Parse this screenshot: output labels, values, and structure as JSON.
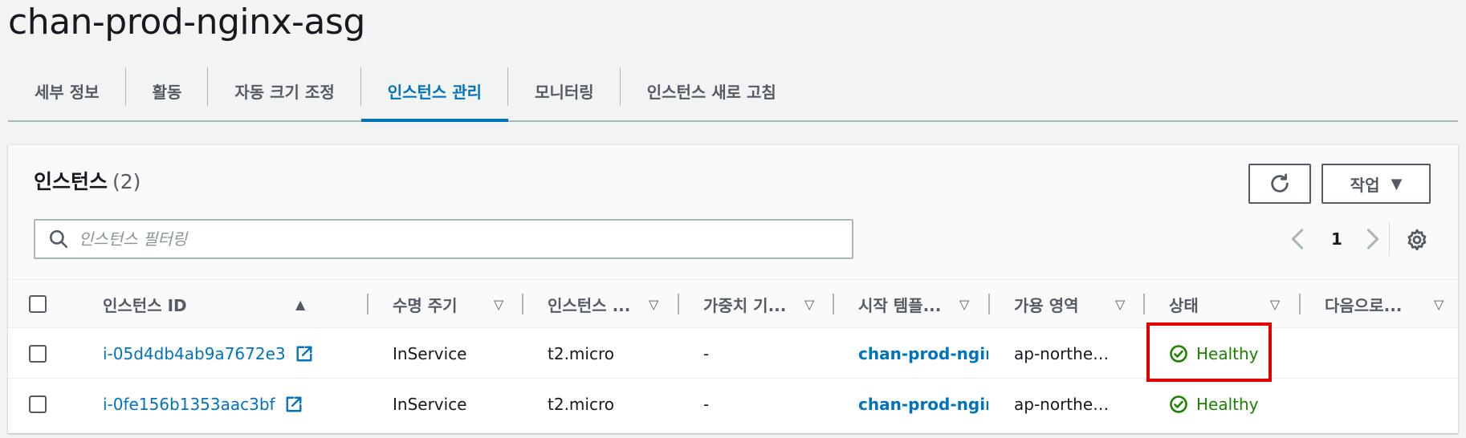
{
  "page": {
    "title": "chan-prod-nginx-asg"
  },
  "tabs": [
    {
      "label": "세부 정보",
      "active": false
    },
    {
      "label": "활동",
      "active": false
    },
    {
      "label": "자동 크기 조정",
      "active": false
    },
    {
      "label": "인스턴스 관리",
      "active": true
    },
    {
      "label": "모니터링",
      "active": false
    },
    {
      "label": "인스턴스 새로 고침",
      "active": false
    }
  ],
  "panel": {
    "title": "인스턴스",
    "count": "(2)",
    "actions_label": "작업",
    "search_placeholder": "인스턴스 필터링",
    "page_number": "1"
  },
  "table": {
    "columns": [
      "인스턴스 ID",
      "수명 주기",
      "인스턴스 ...",
      "가중치 기...",
      "시작 템플...",
      "가용 영역",
      "상태",
      "다음으로..."
    ],
    "rows": [
      {
        "instance_id": "i-05d4db4ab9a7672e3",
        "lifecycle": "InService",
        "instance_type": "t2.micro",
        "weight": "-",
        "launch_template": "chan-prod-nginx",
        "az": "ap-northe…",
        "status": "Healthy",
        "next": ""
      },
      {
        "instance_id": "i-0fe156b1353aac3bf",
        "lifecycle": "InService",
        "instance_type": "t2.micro",
        "weight": "-",
        "launch_template": "chan-prod-nginx",
        "az": "ap-northe…",
        "status": "Healthy",
        "next": ""
      }
    ]
  },
  "colors": {
    "accent": "#0073bb",
    "healthy": "#1d8102",
    "highlight": "#e00000"
  }
}
